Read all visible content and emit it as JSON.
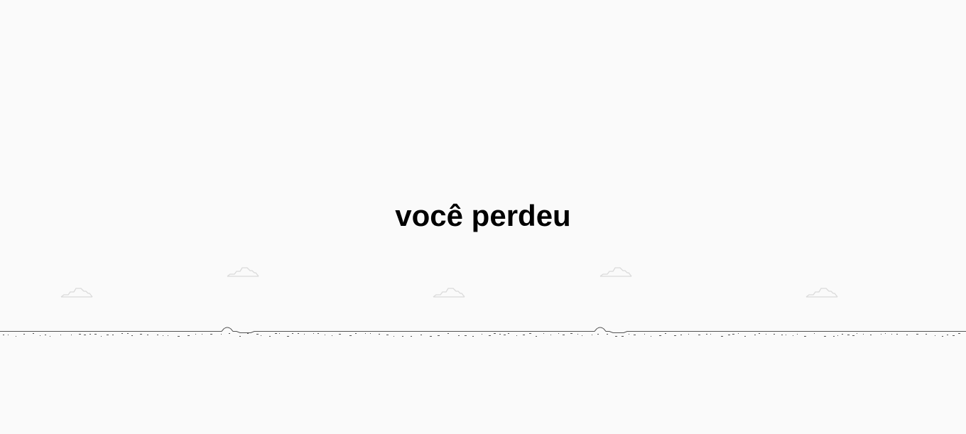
{
  "game": {
    "status_message": "você perdeu"
  },
  "colors": {
    "background": "#fafafa",
    "text": "#000000",
    "ground": "#535353",
    "cloud": "#dadada"
  },
  "icons": {
    "cloud": "cloud-icon",
    "ground": "ground-line"
  }
}
